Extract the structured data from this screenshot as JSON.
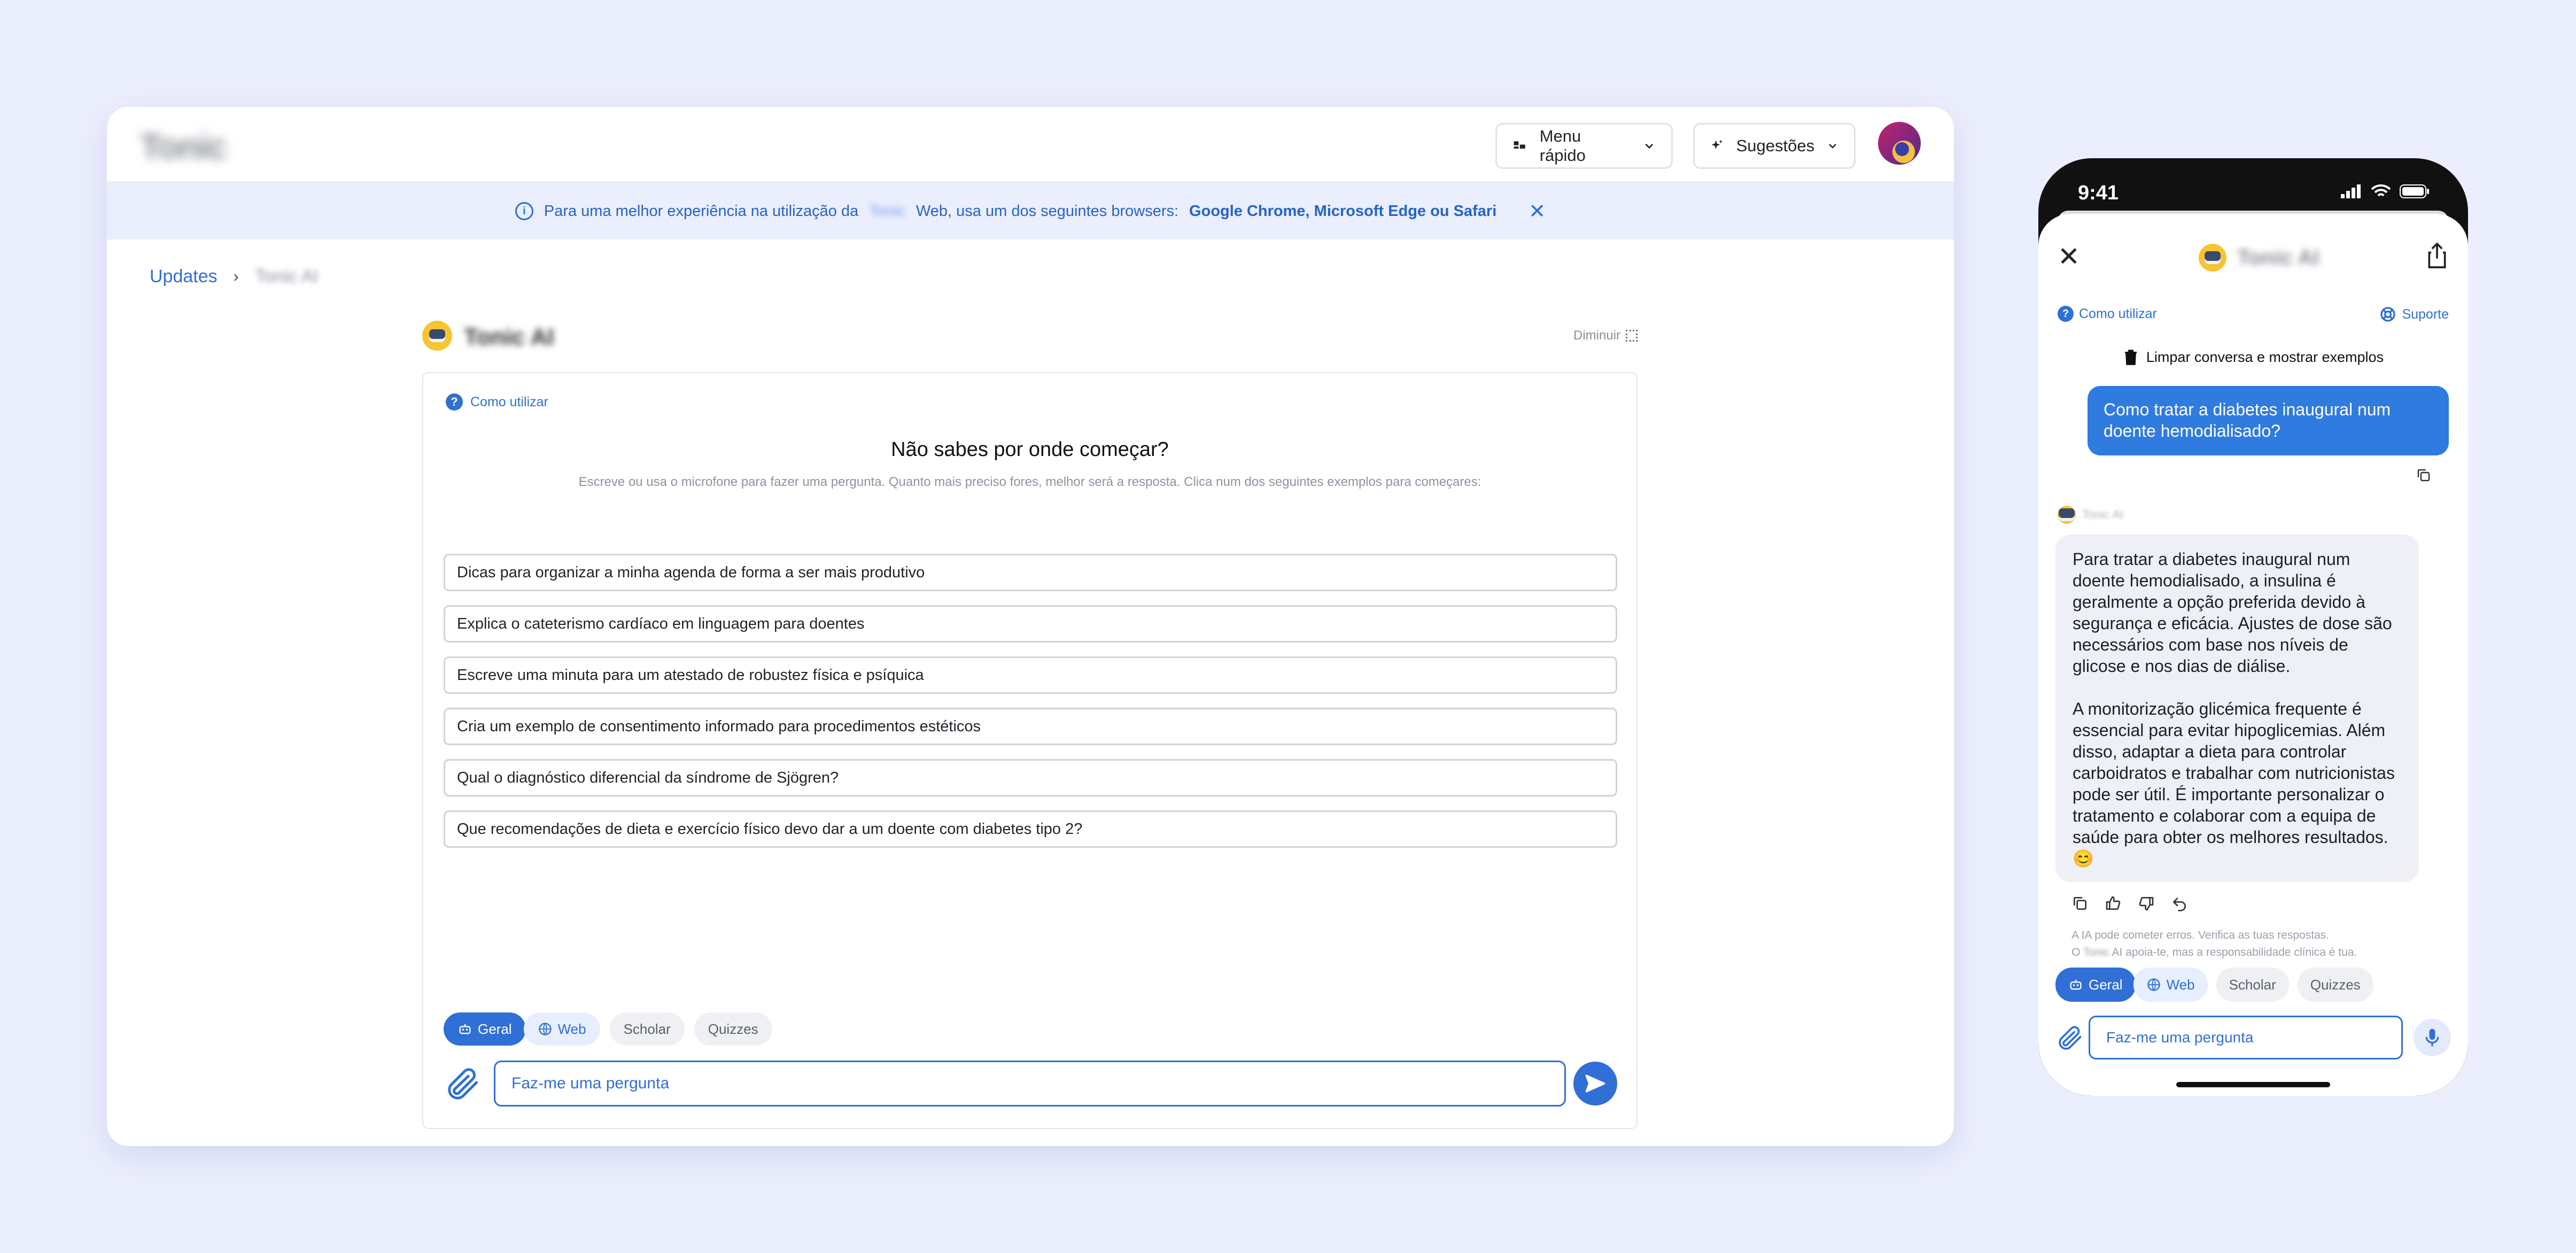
{
  "app": {
    "logo": "Tonic",
    "quick_menu": "Menu rápido",
    "suggestions": "Sugestões"
  },
  "banner": {
    "text_before": "Para uma melhor experiência na utilização da",
    "brand": "Tonic",
    "text_after": "Web, usa um dos seguintes browsers:",
    "browsers": "Google Chrome, Microsoft Edge ou Safari",
    "close": "✕"
  },
  "breadcrumb": {
    "root": "Updates",
    "sep": "›",
    "current": "Tonic AI"
  },
  "assistant": {
    "name": "Tonic AI",
    "minimize": "Diminuir",
    "how_to": "Como utilizar",
    "heading": "Não sabes por onde começar?",
    "subheading": "Escreve ou usa o microfone para fazer uma pergunta. Quanto mais preciso fores, melhor será a resposta. Clica num dos seguintes exemplos para começares:",
    "examples": [
      "Dicas para organizar a minha agenda de forma a ser mais produtivo",
      "Explica o cateterismo cardíaco em linguagem para doentes",
      "Escreve uma minuta para um atestado de robustez física e psíquica",
      "Cria um exemplo de consentimento informado para procedimentos estéticos",
      "Qual o diagnóstico diferencial da síndrome de Sjögren?",
      "Que recomendações de dieta e exercício físico devo dar a um doente com diabetes tipo 2?"
    ],
    "modes": [
      "Geral",
      "Web",
      "Scholar",
      "Quizzes"
    ],
    "input_placeholder": "Faz-me uma pergunta"
  },
  "mobile": {
    "time": "9:41",
    "title": "Tonic AI",
    "how_to": "Como utilizar",
    "support": "Suporte",
    "clear": "Limpar conversa e mostrar exemplos",
    "user_message": "Como tratar a diabetes inaugural num doente hemodialisado?",
    "bot_name": "Tonic AI",
    "bot_message": "Para tratar a diabetes inaugural num doente hemodialisado, a insulina é geralmente a opção preferida devido à segurança e eficácia. Ajustes de dose são necessários com base nos níveis de glicose e nos dias de diálise.\n\nA monitorização glicémica frequente é essencial para evitar hipoglicemias. Além disso, adaptar a dieta para controlar carboidratos e trabalhar com nutricionistas pode ser útil. É importante personalizar o tratamento e colaborar com a equipa de saúde para obter os melhores resultados. 😊",
    "disclaimer_1": "A IA pode cometer erros. Verifica as tuas respostas.",
    "disclaimer_2_a": "O",
    "disclaimer_2_brand": "Tonic",
    "disclaimer_2_b": "AI apoia-te, mas a responsabilidade clínica é tua.",
    "modes": [
      "Geral",
      "Web",
      "Scholar",
      "Quizzes"
    ],
    "input_placeholder": "Faz-me uma pergunta"
  },
  "colors": {
    "background": "#ebeefd",
    "accent": "#2f6fd6",
    "banner": "#eaeefd"
  }
}
